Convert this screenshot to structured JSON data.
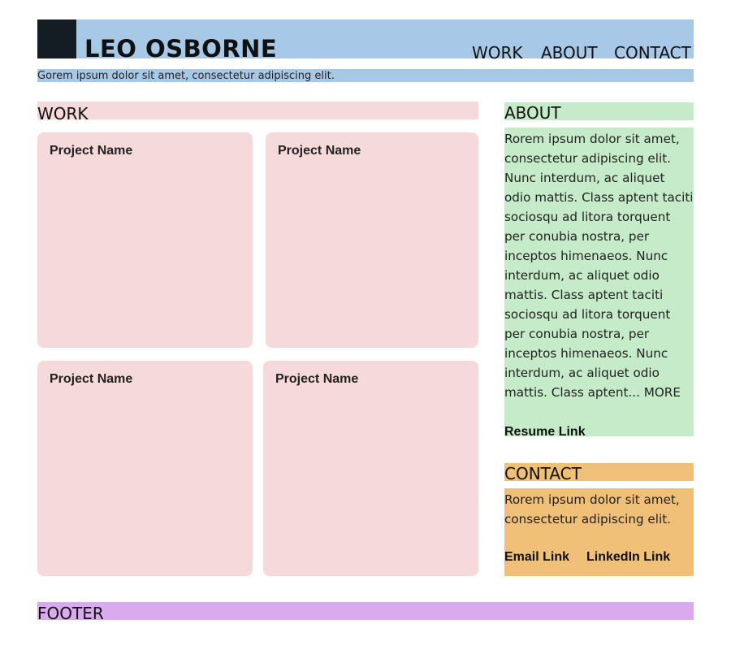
{
  "header": {
    "site_title": "LEO OSBORNE",
    "tagline": "Gorem ipsum dolor sit amet, consectetur adipiscing elit.",
    "nav": [
      "WORK",
      "ABOUT",
      "CONTACT"
    ]
  },
  "work": {
    "heading": "WORK",
    "projects": [
      "Project Name",
      "Project Name",
      "Project Name",
      "Project Name"
    ]
  },
  "about": {
    "heading": "ABOUT",
    "text": "Rorem ipsum dolor sit amet, consectetur adipiscing elit. Nunc interdum, ac aliquet odio mattis. Class aptent taciti sociosqu ad litora torquent per conubia nostra, per inceptos himenaeos. Nunc interdum, ac aliquet odio mattis. Class aptent taciti sociosqu ad litora torquent per conubia nostra, per inceptos himenaeos. Nunc interdum, ac aliquet odio mattis. Class aptent...",
    "more_label": "MORE",
    "resume_link": "Resume Link"
  },
  "contact": {
    "heading": "CONTACT",
    "text": "Rorem ipsum dolor sit amet, consectetur adipiscing elit.",
    "email_link": "Email Link",
    "linkedin_link": "LinkedIn Link"
  },
  "footer": {
    "heading": "FOOTER"
  },
  "colors": {
    "header_blue": "#a8c8e8",
    "logo_dark": "#141c24",
    "work_pink": "#f6d9db",
    "about_green": "#c6ebc9",
    "contact_orange": "#f0c078",
    "footer_purple": "#d9aaee"
  }
}
